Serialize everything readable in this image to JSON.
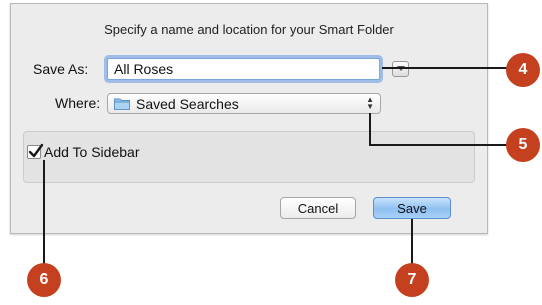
{
  "dialog": {
    "heading": "Specify a name and location for your Smart Folder",
    "save_as_label": "Save As:",
    "save_as_value": "All Roses",
    "where_label": "Where:",
    "where_value": "Saved Searches",
    "add_to_sidebar_label": "Add To Sidebar",
    "add_to_sidebar_checked": true,
    "cancel_label": "Cancel",
    "save_label": "Save"
  },
  "callouts": [
    "4",
    "5",
    "6",
    "7"
  ],
  "colors": {
    "callout_badge": "#c4401e",
    "focus_ring": "#6098e6",
    "default_button": "#8fc0f1",
    "dialog_bg": "#ececec"
  },
  "icons": {
    "folder": "folder-icon",
    "expand": "disclosure-triangle-icon",
    "popup_arrows": "updown-arrows-icon",
    "checkbox": "checkmark-icon"
  }
}
